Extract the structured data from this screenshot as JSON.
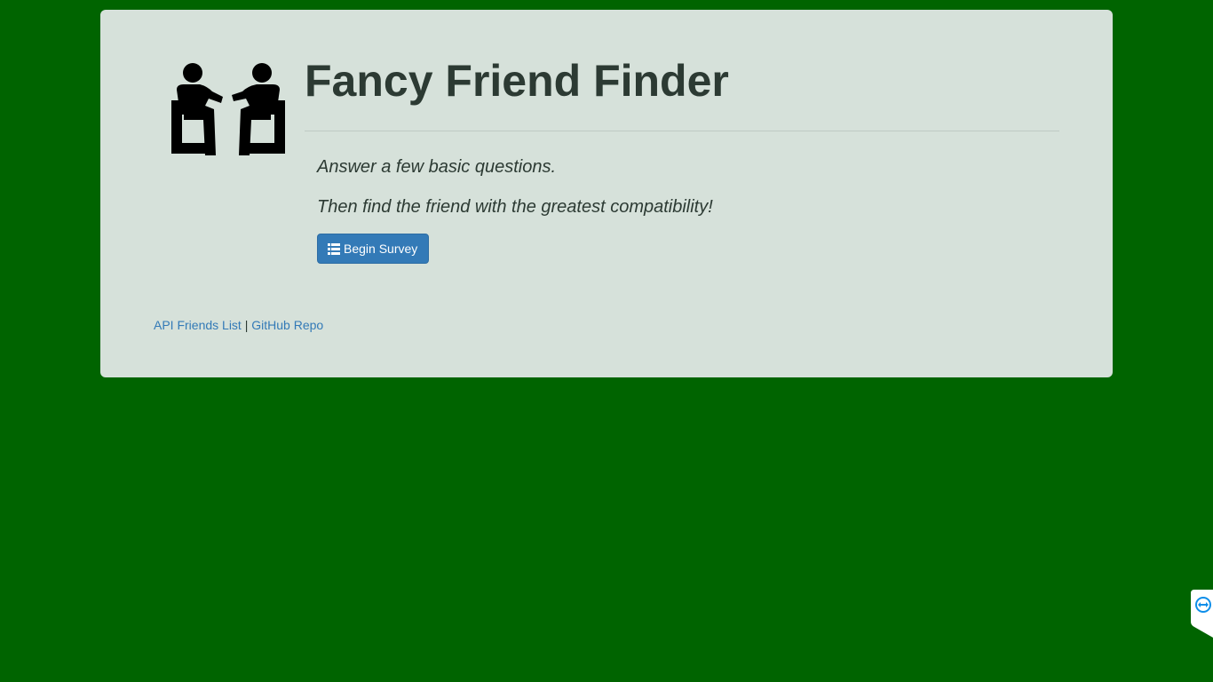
{
  "page": {
    "background_color": "#006400",
    "panel_color": "#d6e1da"
  },
  "header": {
    "logo_icon": "two-people-talking-icon",
    "title": "Fancy Friend Finder"
  },
  "intro": {
    "line1": "Answer a few basic questions.",
    "line2": "Then find the friend with the greatest compatibility!"
  },
  "actions": {
    "begin_survey_icon": "list-icon",
    "begin_survey_label": "Begin Survey",
    "accent_color": "#337ab7"
  },
  "footer": {
    "api_link_label": "API Friends List",
    "separator": "|",
    "github_link_label": "GitHub Repo"
  },
  "overlay": {
    "remote_support_icon": "teamviewer-icon"
  }
}
